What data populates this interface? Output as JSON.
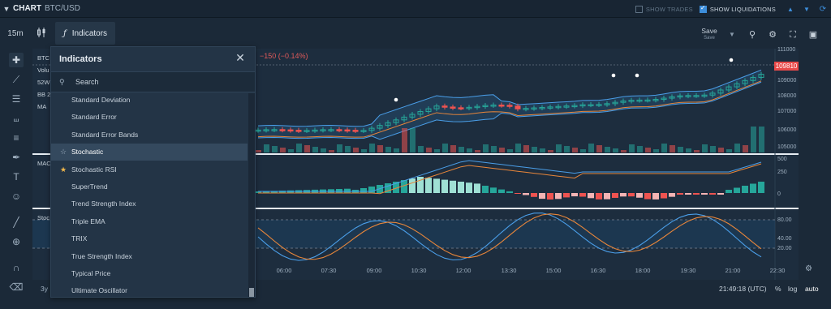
{
  "topbar": {
    "title": "CHART",
    "symbol": "BTC/USD",
    "show_trades": "SHOW TRADES",
    "show_liquidations": "SHOW LIQUIDATIONS"
  },
  "toolbar": {
    "interval": "15m",
    "indicators_label": "Indicators",
    "save_label": "Save",
    "save_sub": "Save"
  },
  "chart": {
    "change_text": "−150 (−0.14%)",
    "last_price": "109810",
    "price_axis": [
      "111000",
      "109000",
      "108000",
      "107000",
      "106000",
      "105000"
    ],
    "macd_axis": [
      "500",
      "250",
      "0"
    ],
    "stoch_axis": [
      "80.00",
      "40.00",
      "20.00"
    ],
    "time_axis": [
      "06:00",
      "07:30",
      "09:00",
      "10:30",
      "12:00",
      "13:30",
      "15:00",
      "16:30",
      "18:00",
      "19:30",
      "21:00",
      "22:30"
    ],
    "legend_partial": {
      "symbol": "BTC",
      "volume": "Volu",
      "week52": "52W",
      "bb": "BB 2",
      "ma": "MA",
      "macd": "MAC",
      "stoch": "Stoc"
    },
    "colors": {
      "up": "#26a69a",
      "down": "#ef5350",
      "bb": "#4a9ee8",
      "ma": "#e8863a"
    }
  },
  "bottom": {
    "range": "3y",
    "clock": "21:49:18 (UTC)",
    "pct": "%",
    "log": "log",
    "auto": "auto"
  },
  "indicators_panel": {
    "title": "Indicators",
    "search_placeholder": "Search",
    "items": [
      {
        "label": "Standard Deviation",
        "star": "none"
      },
      {
        "label": "Standard Error",
        "star": "none"
      },
      {
        "label": "Standard Error Bands",
        "star": "none"
      },
      {
        "label": "Stochastic",
        "star": "outline"
      },
      {
        "label": "Stochastic RSI",
        "star": "filled"
      },
      {
        "label": "SuperTrend",
        "star": "none"
      },
      {
        "label": "Trend Strength Index",
        "star": "none"
      },
      {
        "label": "Triple EMA",
        "star": "none"
      },
      {
        "label": "TRIX",
        "star": "none"
      },
      {
        "label": "True Strength Index",
        "star": "none"
      },
      {
        "label": "Typical Price",
        "star": "none"
      },
      {
        "label": "Ultimate Oscillator",
        "star": "none"
      }
    ]
  }
}
